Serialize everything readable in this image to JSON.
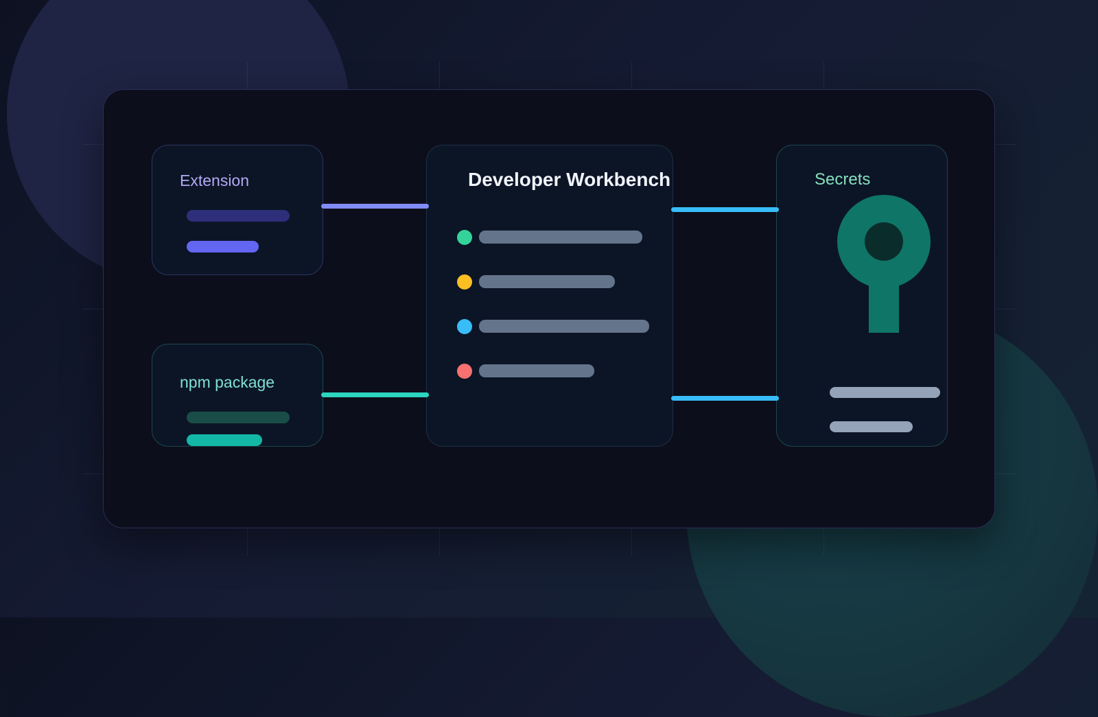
{
  "labels": {
    "extension": "Extension",
    "npm_package": "npm package",
    "workbench_title": "Developer Workbench",
    "secrets": "Secrets"
  },
  "colors": {
    "extension_bar_dim": "#2e2f7a",
    "extension_bar_bright": "#6366f1",
    "npm_bar_dim": "#1b4d48",
    "npm_bar_bright": "#14b8a6",
    "status_green": "#34d399",
    "status_yellow": "#fbbf24",
    "status_blue": "#38bdf8",
    "status_red": "#f87171",
    "list_bar": "#64748b",
    "secret_bar": "#94a3b8",
    "connector_purple": "#818cf8",
    "connector_teal": "#2dd4bf",
    "connector_blue": "#38bdf8",
    "key": "#0f7567"
  },
  "icons": {
    "secrets": "key-icon"
  }
}
